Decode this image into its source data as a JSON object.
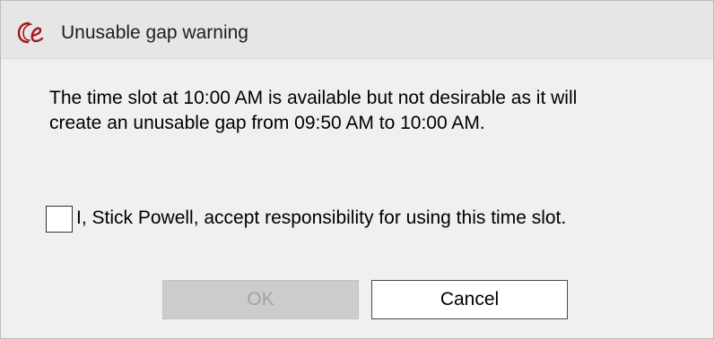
{
  "window": {
    "title": "Unusable gap warning",
    "app_icon": "ce-logo-icon",
    "icon_color": "#a3161b"
  },
  "message": {
    "line1": "The time slot at 10:00 AM is available but not desirable as it will",
    "line2": "create an unusable gap from 09:50 AM to 10:00 AM."
  },
  "acknowledge": {
    "checked": false,
    "label": "I, Stick Powell, accept responsibility for using this time slot."
  },
  "buttons": {
    "ok": {
      "label": "OK",
      "enabled": false
    },
    "cancel": {
      "label": "Cancel",
      "enabled": true
    }
  }
}
